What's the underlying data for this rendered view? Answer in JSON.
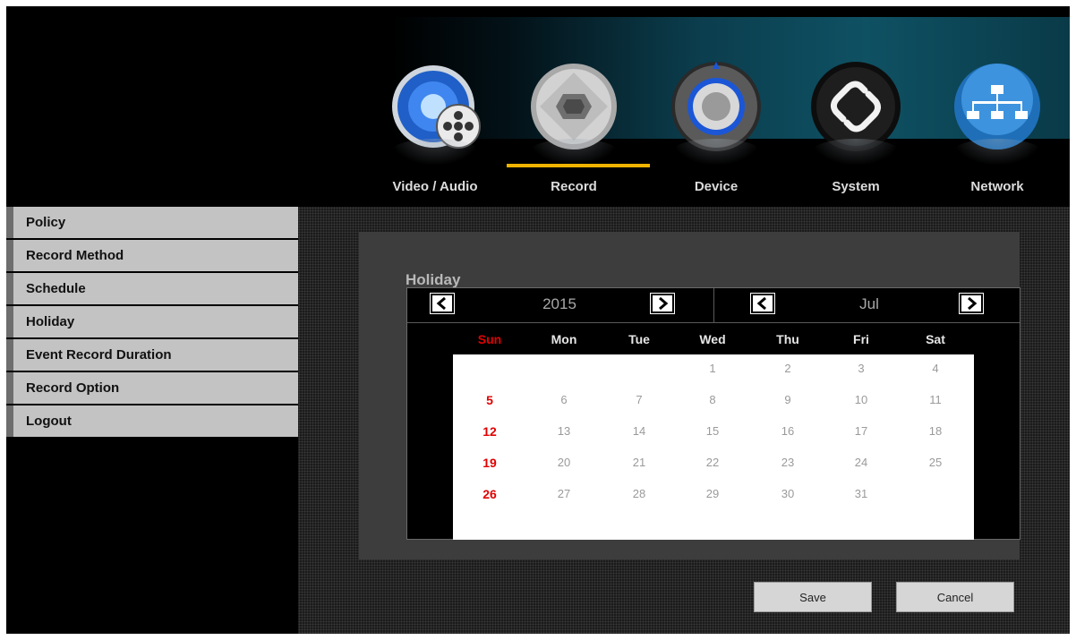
{
  "tabs": [
    {
      "label": "Video / Audio",
      "icon": "speaker-film-reel-icon",
      "active": false
    },
    {
      "label": "Record",
      "icon": "camera-aperture-icon",
      "active": true
    },
    {
      "label": "Device",
      "icon": "knob-dial-icon",
      "active": false
    },
    {
      "label": "System",
      "icon": "link-chain-icon",
      "active": false
    },
    {
      "label": "Network",
      "icon": "network-tree-icon",
      "active": false
    }
  ],
  "sidebar": {
    "items": [
      {
        "label": "Policy"
      },
      {
        "label": "Record Method"
      },
      {
        "label": "Schedule"
      },
      {
        "label": "Holiday"
      },
      {
        "label": "Event Record Duration"
      },
      {
        "label": "Record Option"
      },
      {
        "label": "Logout"
      }
    ]
  },
  "holiday": {
    "title": "Holiday",
    "year": "2015",
    "month": "Jul",
    "weekdays": [
      "Sun",
      "Mon",
      "Tue",
      "Wed",
      "Thu",
      "Fri",
      "Sat"
    ],
    "weeks": [
      [
        "",
        "",
        "",
        "1",
        "2",
        "3",
        "4"
      ],
      [
        "5",
        "6",
        "7",
        "8",
        "9",
        "10",
        "11"
      ],
      [
        "12",
        "13",
        "14",
        "15",
        "16",
        "17",
        "18"
      ],
      [
        "19",
        "20",
        "21",
        "22",
        "23",
        "24",
        "25"
      ],
      [
        "26",
        "27",
        "28",
        "29",
        "30",
        "31",
        ""
      ]
    ]
  },
  "buttons": {
    "save": "Save",
    "cancel": "Cancel"
  },
  "colors": {
    "active_tab_underline": "#f0b400",
    "sunday": "#e00000",
    "sidebar_bg": "#c3c3c3"
  }
}
